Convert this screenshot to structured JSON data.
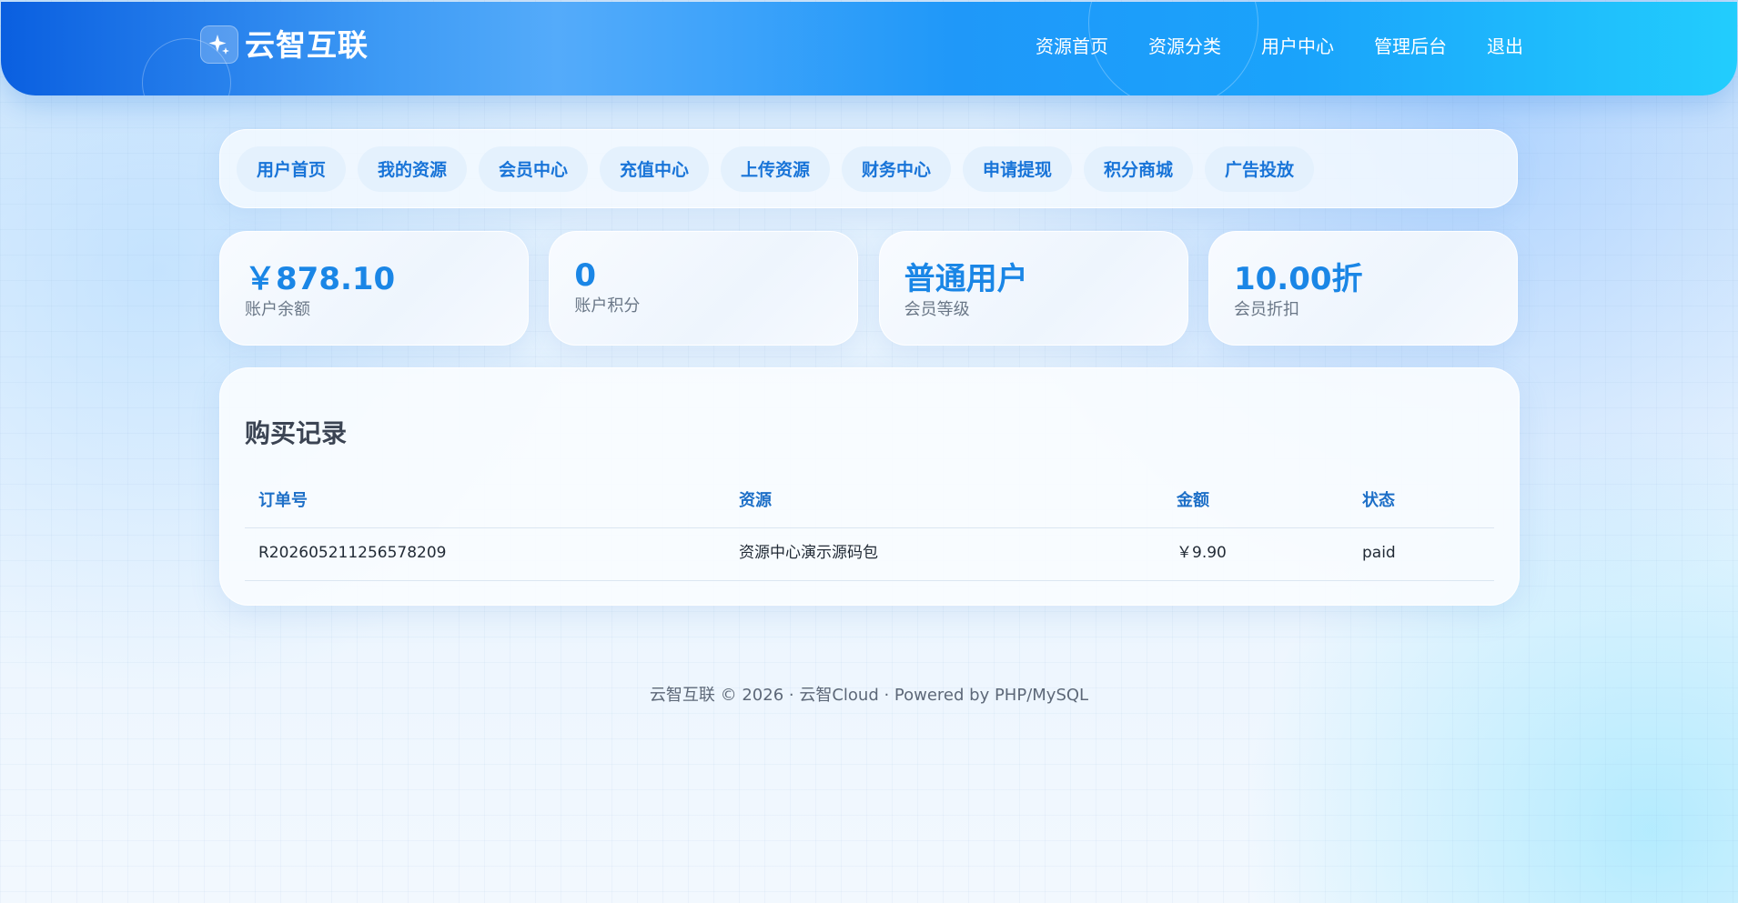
{
  "header": {
    "brand": "云智互联",
    "nav": [
      "资源首页",
      "资源分类",
      "用户中心",
      "管理后台",
      "退出"
    ]
  },
  "subnav": {
    "items": [
      "用户首页",
      "我的资源",
      "会员中心",
      "充值中心",
      "上传资源",
      "财务中心",
      "申请提现",
      "积分商城",
      "广告投放"
    ]
  },
  "stats": [
    {
      "value": "￥878.10",
      "label": "账户余额"
    },
    {
      "value": "0",
      "label": "账户积分"
    },
    {
      "value": "普通用户",
      "label": "会员等级"
    },
    {
      "value": "10.00折",
      "label": "会员折扣"
    }
  ],
  "records": {
    "title": "购买记录",
    "columns": [
      "订单号",
      "资源",
      "金额",
      "状态"
    ],
    "rows": [
      [
        "R202605211256578209",
        "资源中心演示源码包",
        "￥9.90",
        "paid"
      ]
    ]
  },
  "footer": {
    "text": "云智互联 © 2026 · 云智Cloud · Powered by PHP/MySQL"
  },
  "colors": {
    "accent": "#1a86e6",
    "pill_bg": "#e4f1fd",
    "pill_text": "#1874d8",
    "header_start": "#0a5fe0",
    "header_end": "#22cdfd"
  }
}
